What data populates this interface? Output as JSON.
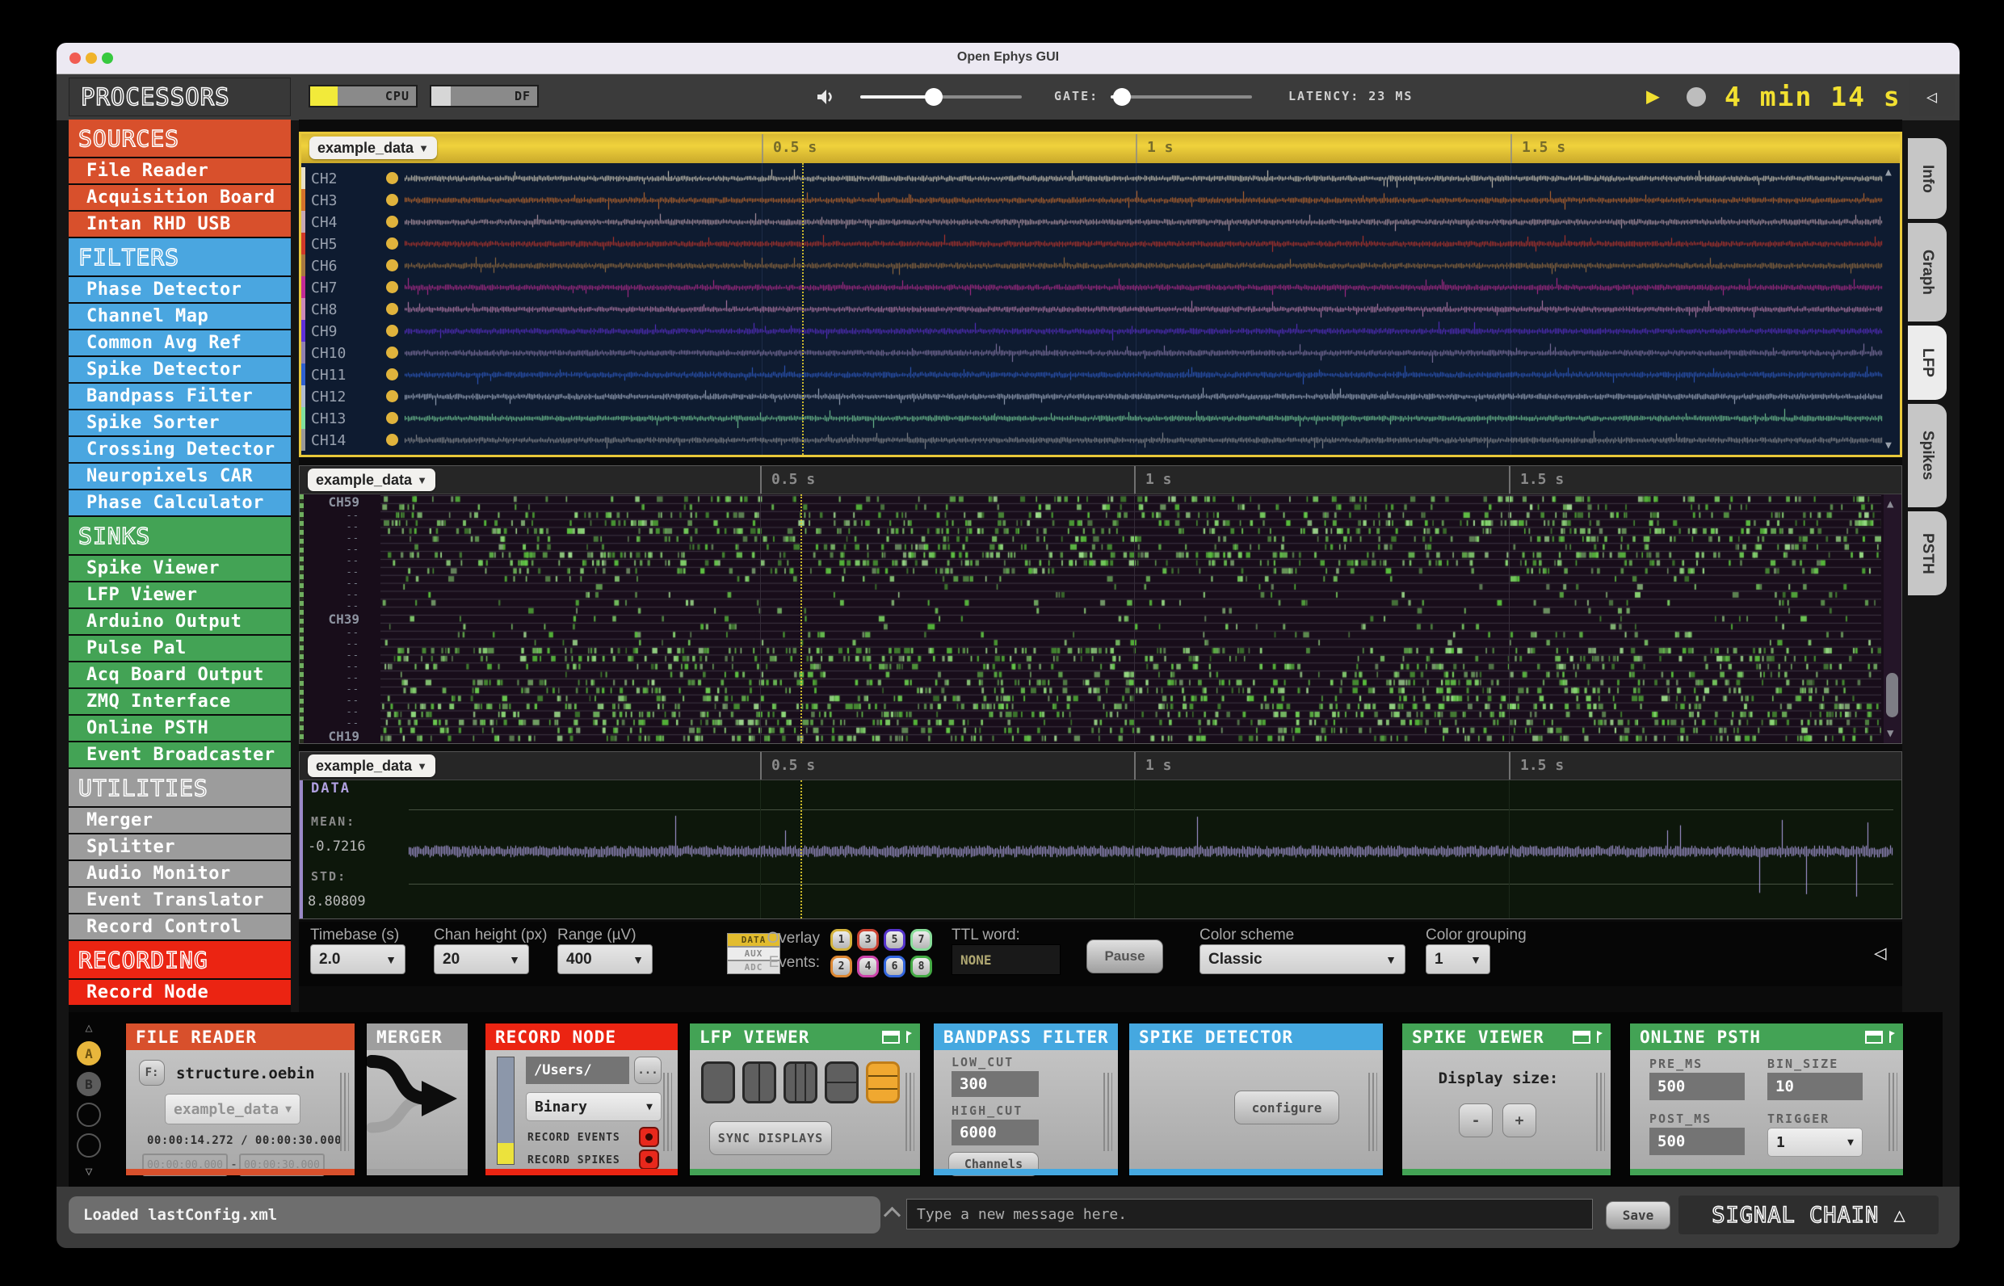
{
  "window": {
    "title": "Open Ephys GUI"
  },
  "toolbar": {
    "cpu_label": "CPU",
    "df_label": "DF",
    "gate_label": "GATE:",
    "latency_label": "LATENCY: 23 MS",
    "timer": "4 min 14 s"
  },
  "sidebar": {
    "title": "PROCESSORS",
    "sections": [
      {
        "label": "SOURCES",
        "color": "#D8502C",
        "items": [
          "File Reader",
          "Acquisition Board",
          "Intan RHD USB"
        ]
      },
      {
        "label": "FILTERS",
        "color": "#4AA6E0",
        "items": [
          "Phase Detector",
          "Channel Map",
          "Common Avg Ref",
          "Spike Detector",
          "Bandpass Filter",
          "Spike Sorter",
          "Crossing Detector",
          "Neuropixels CAR",
          "Phase Calculator"
        ]
      },
      {
        "label": "SINKS",
        "color": "#43A355",
        "items": [
          "Spike Viewer",
          "LFP Viewer",
          "Arduino Output",
          "Pulse Pal",
          "Acq Board Output",
          "ZMQ Interface",
          "Online PSTH",
          "Event Broadcaster"
        ]
      },
      {
        "label": "UTILITIES",
        "color": "#9C9C9C",
        "items": [
          "Merger",
          "Splitter",
          "Audio Monitor",
          "Event Translator",
          "Record Control"
        ]
      },
      {
        "label": "RECORDING",
        "color": "#EB2412",
        "items": [
          "Record Node"
        ]
      }
    ]
  },
  "viewers": {
    "lfp": {
      "selector": "example_data",
      "time_markers": [
        "0.5 s",
        "1 s",
        "1.5 s"
      ],
      "channels": [
        {
          "name": "CH2",
          "color": "#E8E0C8"
        },
        {
          "name": "CH3",
          "color": "#D4722C"
        },
        {
          "name": "CH4",
          "color": "#C8A8B4"
        },
        {
          "name": "CH5",
          "color": "#D0392A"
        },
        {
          "name": "CH6",
          "color": "#A87840"
        },
        {
          "name": "CH7",
          "color": "#C22C96"
        },
        {
          "name": "CH8",
          "color": "#CC88B8"
        },
        {
          "name": "CH9",
          "color": "#6030D8"
        },
        {
          "name": "CH10",
          "color": "#9080B0"
        },
        {
          "name": "CH11",
          "color": "#3060D0"
        },
        {
          "name": "CH12",
          "color": "#B0BCD0"
        },
        {
          "name": "CH13",
          "color": "#80E0A0"
        },
        {
          "name": "CH14",
          "color": "#989898"
        }
      ]
    },
    "raster": {
      "selector": "example_data",
      "time_markers": [
        "0.5 s",
        "1 s",
        "1.5 s"
      ],
      "labels": [
        "CH59",
        "CH39",
        "CH19"
      ],
      "label_rows": [
        0,
        10,
        20
      ],
      "rows": 31,
      "dash": "--"
    },
    "data": {
      "selector": "example_data",
      "time_markers": [
        "0.5 s",
        "1 s",
        "1.5 s"
      ],
      "title": "DATA",
      "mean_label": "MEAN:",
      "mean_value": "-0.7216",
      "std_label": "STD:",
      "std_value": "8.80809"
    }
  },
  "controls": {
    "timebase": {
      "label": "Timebase (s)",
      "value": "2.0"
    },
    "chan_height": {
      "label": "Chan height (px)",
      "value": "20"
    },
    "range": {
      "label": "Range (µV)",
      "value": "400"
    },
    "stream_tabs": [
      "DATA",
      "AUX",
      "ADC"
    ],
    "overlay_label_1": "Overlay",
    "overlay_label_2": "Events:",
    "event_buttons": [
      {
        "n": "1",
        "color": "#D4B33C"
      },
      {
        "n": "2",
        "color": "#DD8833"
      },
      {
        "n": "3",
        "color": "#CC4433"
      },
      {
        "n": "4",
        "color": "#CC44AA"
      },
      {
        "n": "5",
        "color": "#5533CC"
      },
      {
        "n": "6",
        "color": "#3366DD"
      },
      {
        "n": "7",
        "color": "#88DD99"
      },
      {
        "n": "8",
        "color": "#44AA44"
      }
    ],
    "ttl": {
      "label": "TTL word:",
      "value": "NONE"
    },
    "pause_label": "Pause",
    "color_scheme": {
      "label": "Color scheme",
      "value": "Classic"
    },
    "color_grouping": {
      "label": "Color grouping",
      "value": "1"
    }
  },
  "right_tabs": {
    "tabs": [
      "Info",
      "Graph",
      "LFP",
      "Spikes",
      "PSTH"
    ],
    "active": "LFP"
  },
  "signal_chain": {
    "selector_a": "A",
    "selector_b": "B",
    "file_reader": {
      "title": "FILE READER",
      "f_button": "F:",
      "file": "structure.oebin",
      "dropdown": "example_data",
      "time": "00:00:14.272 / 00:00:30.000",
      "start": "00:00:00.000",
      "dash": "-",
      "end": "00:00:30.000"
    },
    "merger": {
      "title": "MERGER"
    },
    "record_node": {
      "title": "RECORD NODE",
      "path": "/Users/",
      "browse": "...",
      "engine": "Binary",
      "events_label": "RECORD EVENTS",
      "spikes_label": "RECORD SPIKES"
    },
    "lfp_viewer": {
      "title": "LFP VIEWER",
      "sync_button": "SYNC DISPLAYS"
    },
    "bandpass": {
      "title": "BANDPASS FILTER",
      "low_label": "LOW_CUT",
      "low_value": "300",
      "high_label": "HIGH_CUT",
      "high_value": "6000",
      "channels_button": "Channels"
    },
    "spike_detector": {
      "title": "SPIKE DETECTOR",
      "configure_button": "configure"
    },
    "spike_viewer": {
      "title": "SPIKE VIEWER",
      "display_label": "Display size:",
      "minus": "-",
      "plus": "+"
    },
    "online_psth": {
      "title": "ONLINE PSTH",
      "pre_label": "PRE_MS",
      "pre_value": "500",
      "bin_label": "BIN_SIZE",
      "bin_value": "10",
      "post_label": "POST_MS",
      "post_value": "500",
      "trigger_label": "TRIGGER",
      "trigger_value": "1"
    }
  },
  "status_bar": {
    "message": "Loaded lastConfig.xml",
    "placeholder": "Type a new message here.",
    "save_label": "Save",
    "title": "SIGNAL CHAIN"
  },
  "colors": {
    "accent_yellow": "#F0D23C",
    "sources_orange": "#D8502C",
    "filters_blue": "#4AA6E0",
    "sinks_green": "#43A355",
    "utilities_gray": "#9C9C9C",
    "recording_red": "#EB2412",
    "timer_yellow": "#F2E030"
  }
}
